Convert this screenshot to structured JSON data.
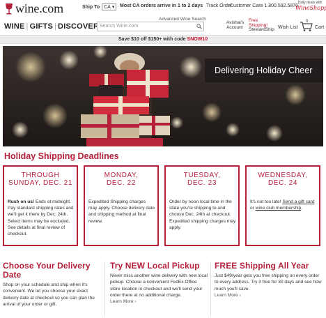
{
  "header": {
    "logo_text": "wine.com",
    "ship_to_label": "Ship To",
    "ship_to_state": "CA",
    "promo_text": "Most CA orders arrive in 1 to 2 days",
    "track_order": "Track Order",
    "customer_care": "Customer Care 1.800.592.5870",
    "daily_deals_text": "Daily deals with",
    "daily_deals_brand": "WineShopper"
  },
  "nav": {
    "wine": "WINE",
    "gifts": "GIFTS",
    "discover": "DISCOVER",
    "advanced_search": "Advanced Wine Search",
    "search_placeholder": "Search Wine.com",
    "account_line1": "Avishai's",
    "account_line2": "Account",
    "steward_line1": "Free",
    "steward_line2": "Shipping!",
    "steward_line3": "StewardShip",
    "wish_list": "Wish List",
    "cart_label": "Cart",
    "cart_count": "0"
  },
  "promo_bar": {
    "text": "Save $10 off $150+ with code ",
    "code": "SNOW10"
  },
  "hero": {
    "caption": "Delivering Holiday Cheer"
  },
  "deadlines": {
    "title": "Holiday Shipping Deadlines",
    "cards": [
      {
        "line1": "THROUGH",
        "line2": "SUNDAY, DEC. 21",
        "lead": "Rush on us!",
        "text": " Ends at midnight. Pay standard shipping rates and we'll get it there by Dec. 24th. Select items may be excluded. See details at final review of checkout."
      },
      {
        "line1": "MONDAY,",
        "line2": "DEC. 22",
        "text": "Expedited Shipping charges may apply. Choose delivery date and shipping method at final review."
      },
      {
        "line1": "TUESDAY,",
        "line2": "DEC. 23",
        "text": "Order by noon local time in the state you're shipping to and choose Dec. 24th at checkout. Expedited shipping charges may apply."
      },
      {
        "line1": "WEDNESDAY,",
        "line2": "DEC. 24",
        "text_a": "It's not too late! ",
        "link1": "Send a gift card",
        "text_b": " or ",
        "link2": "wine club membership",
        "text_c": "."
      }
    ]
  },
  "features": [
    {
      "title_line1": "Choose Your Delivery",
      "title_line2": "Date",
      "body": "Shop on your schedule and ship when it's convenient. We let you choose your exact delivery date at checkout so you can plan the arrival of your order or gift."
    },
    {
      "title_line1": "Try NEW Local Pickup",
      "body": "Never miss another wine delivery with new local pickup. Choose a convenient FedEx Office store location in checkout and we'll send your order there at no additional charge.",
      "learn_more": "Learn More ›"
    },
    {
      "title_line1": "FREE Shipping All Year",
      "body": "Just $49/year gets you free shipping on every order to every address. Try it free for 30 days and see how much you'll save.",
      "learn_more": "Learn More ›"
    }
  ],
  "colors": {
    "brand_red": "#b5203a",
    "promo_bg": "#ececec"
  }
}
